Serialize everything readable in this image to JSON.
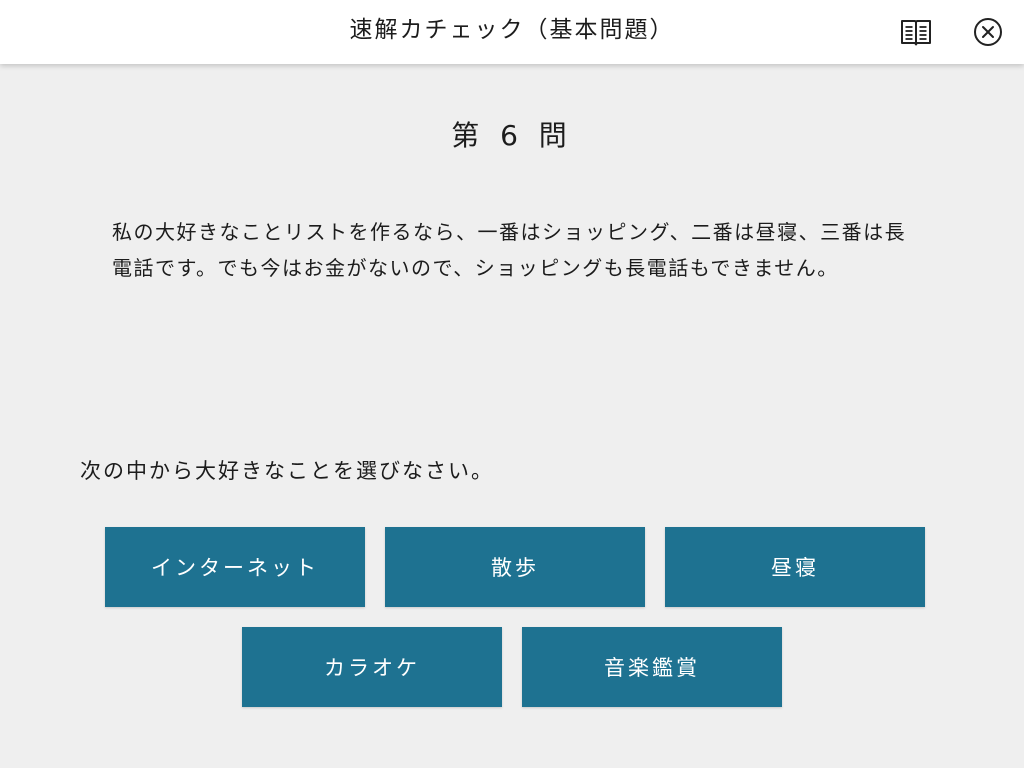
{
  "header": {
    "title": "速解カチェック（基本問題）",
    "book_icon": "book-icon",
    "close_icon": "close-circle-icon"
  },
  "question": {
    "number_label": "第 6 問",
    "passage": "私の大好きなことリストを作るなら、一番はショッピング、二番は昼寝、三番は長電話です。でも今はお金がないので、ショッピングも長電話もできません。",
    "instruction": "次の中から大好きなことを選びなさい。"
  },
  "choices": [
    {
      "label": "インターネット"
    },
    {
      "label": "散歩"
    },
    {
      "label": "昼寝"
    },
    {
      "label": "カラオケ"
    },
    {
      "label": "音楽鑑賞"
    }
  ],
  "colors": {
    "choice_bg": "#1e7291",
    "page_bg": "#efefef",
    "header_bg": "#ffffff"
  }
}
